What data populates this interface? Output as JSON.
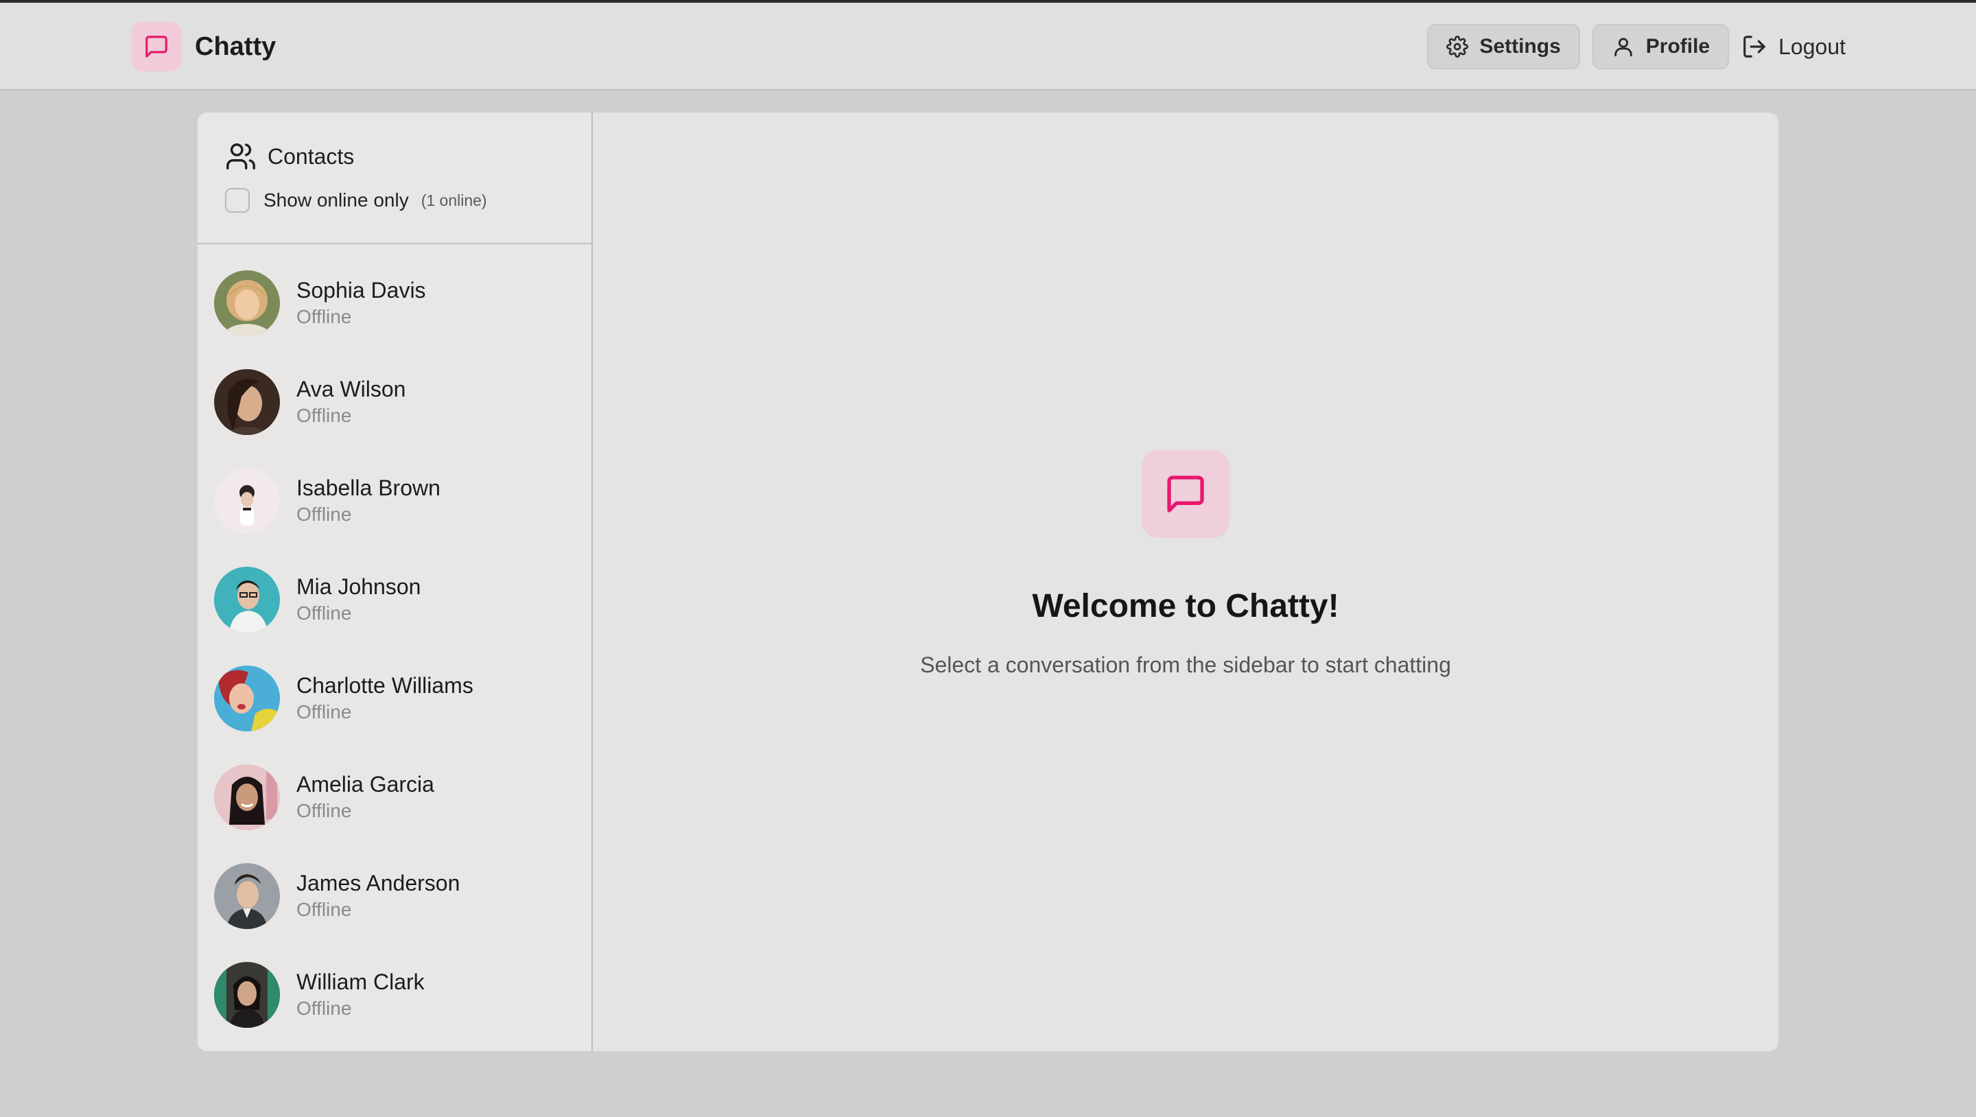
{
  "app": {
    "name": "Chatty",
    "accent": "#e8176e",
    "accent_bg": "#f2cbd8"
  },
  "navbar": {
    "settings_label": "Settings",
    "profile_label": "Profile",
    "logout_label": "Logout",
    "settings_icon": "gear-icon",
    "profile_icon": "user-icon",
    "logout_icon": "logout-icon"
  },
  "sidebar": {
    "title": "Contacts",
    "title_icon": "users-icon",
    "filter_label": "Show online only",
    "filter_checked": false,
    "online_count": "(1 online)",
    "contacts": [
      {
        "name": "Sophia Davis",
        "status": "Offline"
      },
      {
        "name": "Ava Wilson",
        "status": "Offline"
      },
      {
        "name": "Isabella Brown",
        "status": "Offline"
      },
      {
        "name": "Mia Johnson",
        "status": "Offline"
      },
      {
        "name": "Charlotte Williams",
        "status": "Offline"
      },
      {
        "name": "Amelia Garcia",
        "status": "Offline"
      },
      {
        "name": "James Anderson",
        "status": "Offline"
      },
      {
        "name": "William Clark",
        "status": "Offline"
      }
    ]
  },
  "main": {
    "welcome_icon": "message-square-icon",
    "welcome_title": "Welcome to Chatty!",
    "welcome_subtitle": "Select a conversation from the sidebar to start chatting"
  }
}
